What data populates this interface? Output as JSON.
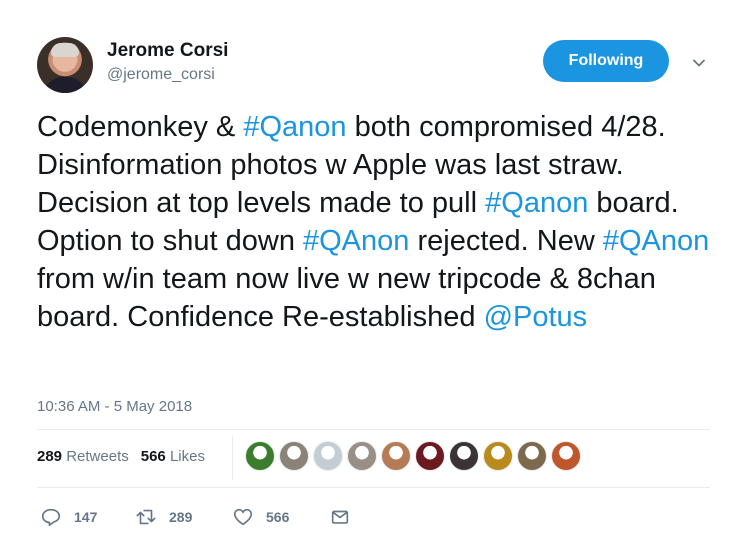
{
  "author": {
    "name": "Jerome Corsi",
    "handle": "@jerome_corsi"
  },
  "follow_button": {
    "label": "Following"
  },
  "tweet": {
    "segments": [
      {
        "text": "Codemonkey & ",
        "link": false
      },
      {
        "text": "#Qanon",
        "link": true
      },
      {
        "text": " both compromised 4/28. Disinformation photos w Apple was last straw. Decision at top levels made to pull ",
        "link": false
      },
      {
        "text": "#Qanon",
        "link": true
      },
      {
        "text": " board. Option to shut down ",
        "link": false
      },
      {
        "text": "#QAnon",
        "link": true
      },
      {
        "text": " rejected. New ",
        "link": false
      },
      {
        "text": "#QAnon",
        "link": true
      },
      {
        "text": " from w/in team now live w new tripcode & 8chan board. Confidence Re-established ",
        "link": false
      },
      {
        "text": "@Potus",
        "link": true
      }
    ],
    "timestamp": "10:36 AM - 5 May 2018"
  },
  "stats": {
    "retweets_count": "289",
    "retweets_label": "Retweets",
    "likes_count": "566",
    "likes_label": "Likes"
  },
  "likers": [
    {
      "icon": "robin-logo-avatar",
      "color": "#3a7d2c"
    },
    {
      "icon": "group-photo-avatar",
      "color": "#8a8478"
    },
    {
      "icon": "default-profile-avatar",
      "color": "#c4ccd4"
    },
    {
      "icon": "crowd-photo-avatar",
      "color": "#9a8f86"
    },
    {
      "icon": "woman-portrait-avatar",
      "color": "#b57b55"
    },
    {
      "icon": "red-portrait-avatar",
      "color": "#6d1a1f"
    },
    {
      "icon": "dark-scene-avatar",
      "color": "#3b3436"
    },
    {
      "icon": "gold-emblem-avatar",
      "color": "#b98a1c"
    },
    {
      "icon": "landscape-avatar",
      "color": "#7d6a4e"
    },
    {
      "icon": "flame-avatar",
      "color": "#c0572a"
    }
  ],
  "actions": {
    "replies": "147",
    "retweets": "289",
    "likes": "566"
  },
  "colors": {
    "link": "#1b95e0",
    "muted": "#657786",
    "button": "#1b95e0"
  }
}
